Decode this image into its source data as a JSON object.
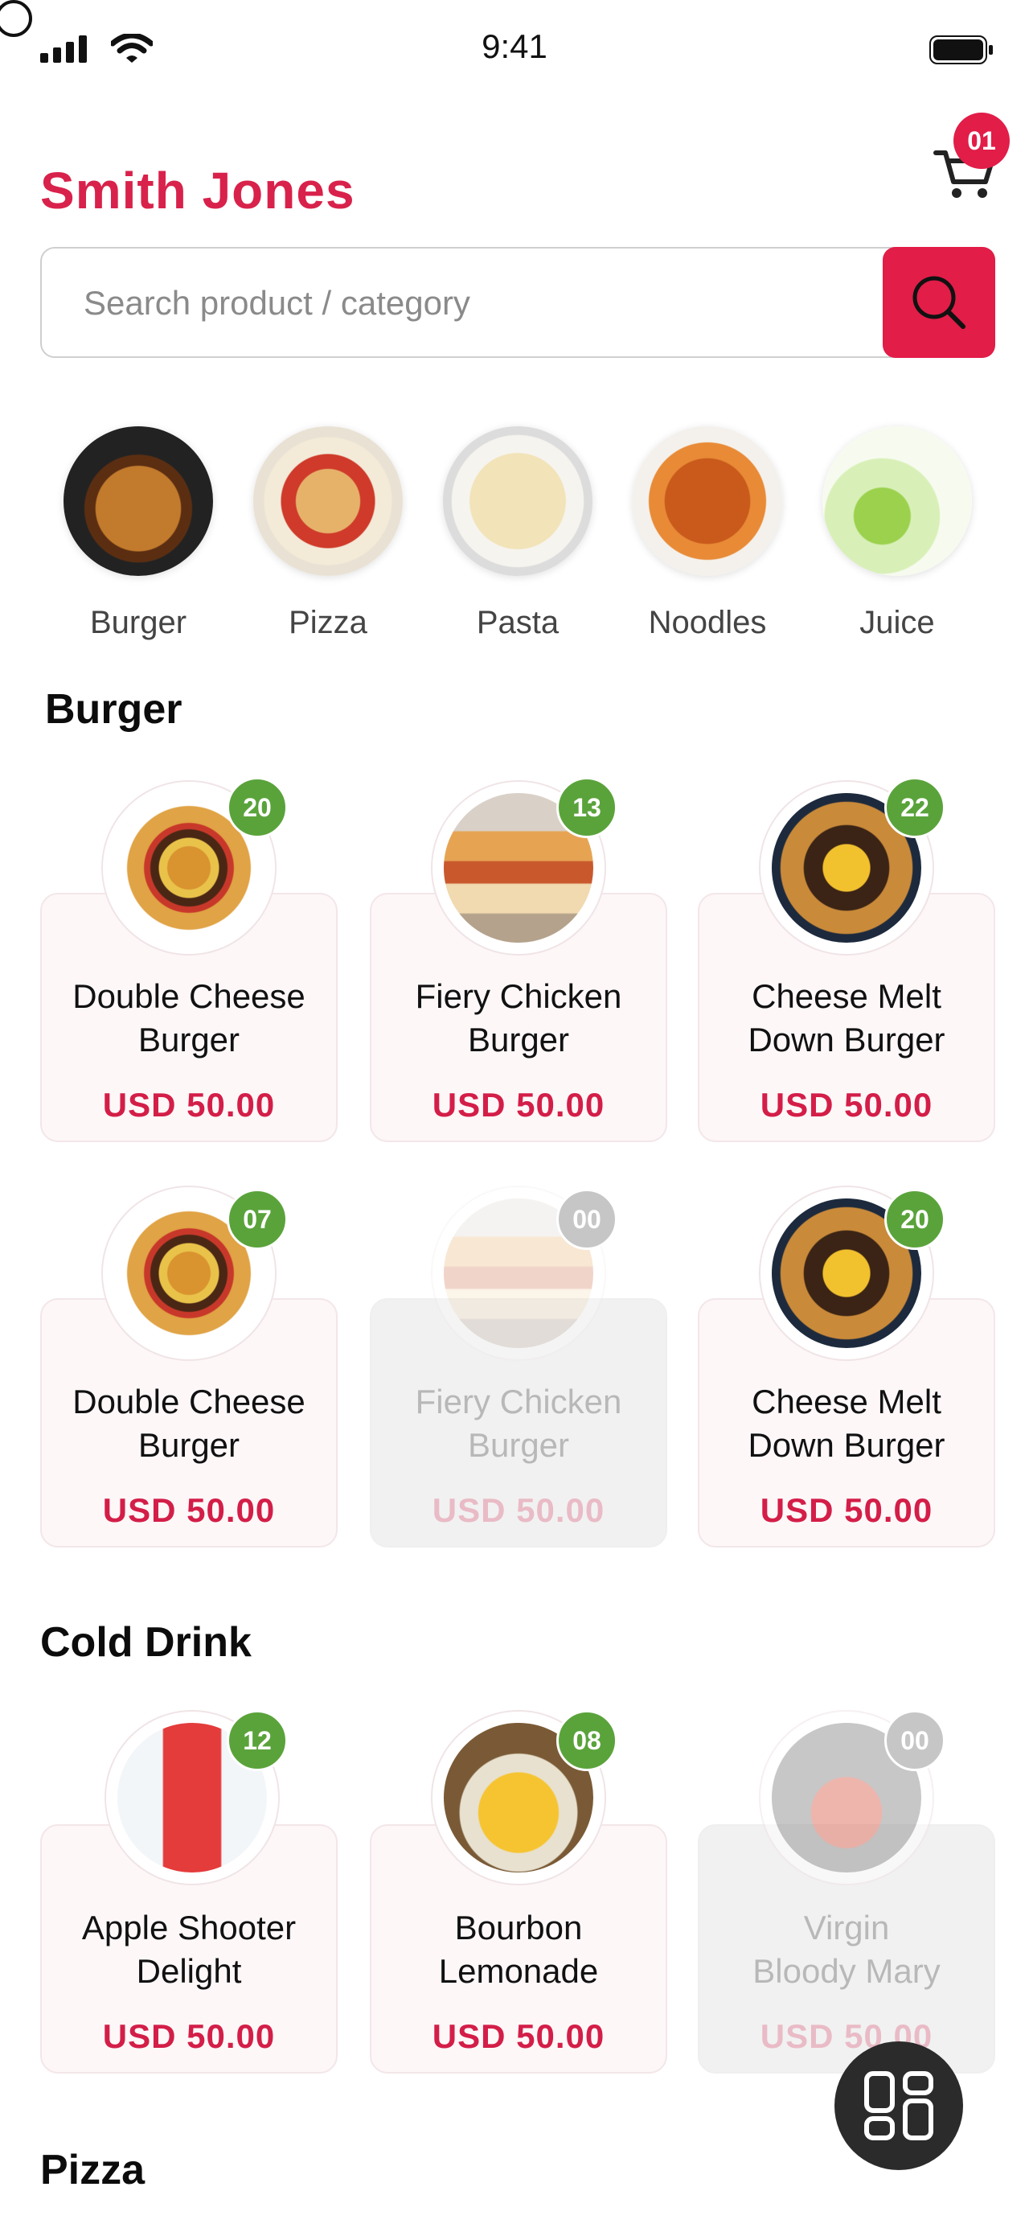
{
  "status_bar": {
    "time": "9:41"
  },
  "header": {
    "user_name": "Smith Jones",
    "cart_count": "01"
  },
  "search": {
    "placeholder": "Search product / category"
  },
  "categories": [
    {
      "label": "Burger"
    },
    {
      "label": "Pizza"
    },
    {
      "label": "Pasta"
    },
    {
      "label": "Noodles"
    },
    {
      "label": "Juice"
    }
  ],
  "sections": [
    {
      "title": "Burger",
      "products": [
        {
          "name_line1": "Double Cheese",
          "name_line2": "Burger",
          "price": "USD 50.00",
          "stock": "20",
          "available": true
        },
        {
          "name_line1": "Fiery Chicken",
          "name_line2": "Burger",
          "price": "USD 50.00",
          "stock": "13",
          "available": true
        },
        {
          "name_line1": "Cheese Melt",
          "name_line2": "Down Burger",
          "price": "USD 50.00",
          "stock": "22",
          "available": true
        },
        {
          "name_line1": "Double Cheese",
          "name_line2": "Burger",
          "price": "USD 50.00",
          "stock": "07",
          "available": true
        },
        {
          "name_line1": "Fiery Chicken",
          "name_line2": "Burger",
          "price": "USD 50.00",
          "stock": "00",
          "available": false
        },
        {
          "name_line1": "Cheese Melt",
          "name_line2": "Down Burger",
          "price": "USD 50.00",
          "stock": "20",
          "available": true
        }
      ]
    },
    {
      "title": "Cold Drink",
      "products": [
        {
          "name_line1": "Apple Shooter",
          "name_line2": "Delight",
          "price": "USD 50.00",
          "stock": "12",
          "available": true
        },
        {
          "name_line1": "Bourbon",
          "name_line2": "Lemonade",
          "price": "USD 50.00",
          "stock": "08",
          "available": true
        },
        {
          "name_line1": "Virgin",
          "name_line2": "Bloody Mary",
          "price": "USD 50.00",
          "stock": "00",
          "available": false
        }
      ]
    },
    {
      "title": "Pizza"
    }
  ],
  "colors": {
    "accent": "#e11d48",
    "in_stock": "#5aa33b",
    "out_of_stock": "#c6c6c6"
  },
  "icons": [
    "signal-icon",
    "wifi-icon",
    "battery-icon",
    "cart-icon",
    "search-icon",
    "grid-menu-icon"
  ]
}
